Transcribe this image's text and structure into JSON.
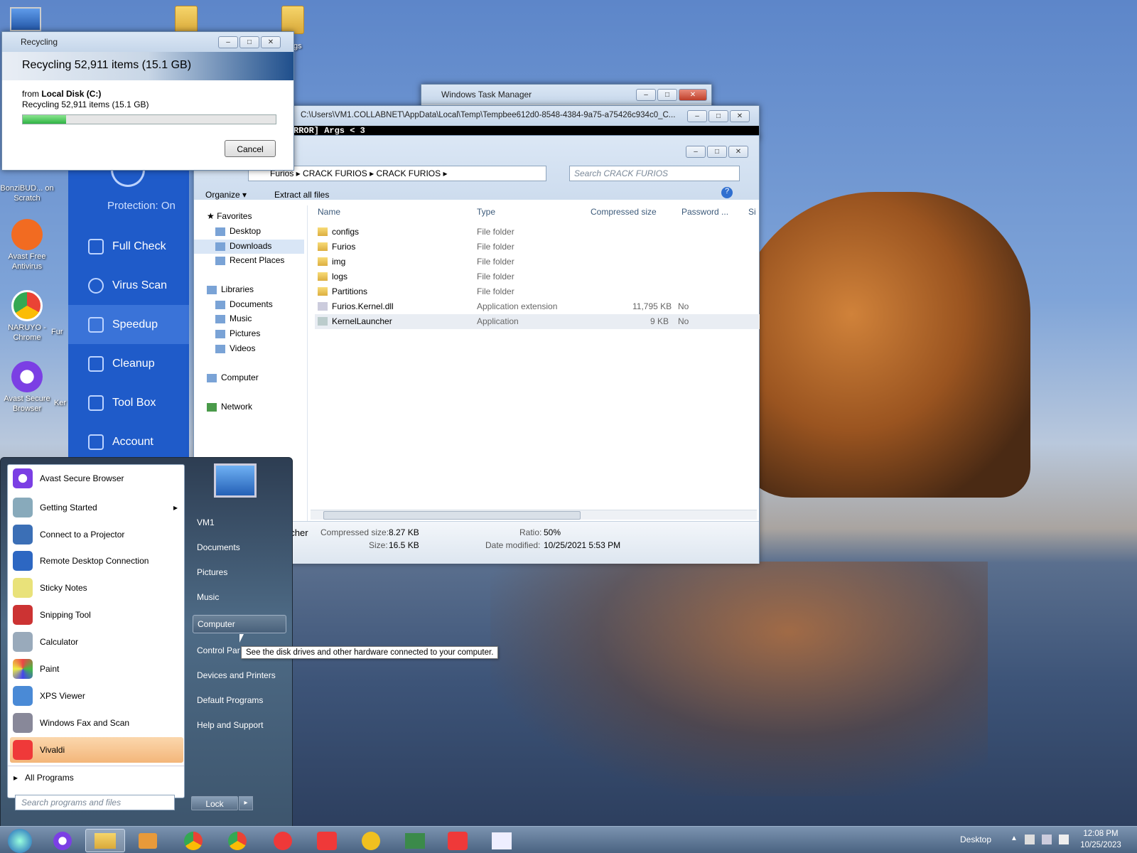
{
  "colors": {
    "accent": "#1f5bc9",
    "progress": "#33c14a",
    "highlight": "#f5c28a"
  },
  "desktop": {
    "icons": [
      {
        "label": "BonziBUD... on Scratch"
      },
      {
        "label": "Avast Free Antivirus"
      },
      {
        "label": "NARUYO - Chrome"
      },
      {
        "label": "Avast Secure Browser"
      },
      {
        "label": "afigs"
      },
      {
        "label": "Fur"
      },
      {
        "label": "Ker"
      }
    ]
  },
  "recycling": {
    "title": "Recycling",
    "heading": "Recycling 52,911 items (15.1 GB)",
    "from_prefix": "from",
    "from_drive": "Local Disk (C:)",
    "status": "Recycling 52,911 items (15.1 GB)",
    "progress": 0.17,
    "cancel": "Cancel"
  },
  "taskmgr": {
    "title": "Windows Task Manager"
  },
  "console": {
    "title": "C:\\Users\\VM1.COLLABNET\\AppData\\Local\\Temp\\Tempbee612d0-8548-4384-9a75-a75426c934c0_C...",
    "line": "RROR] Args < 3"
  },
  "avast": {
    "protection": "Protection: On",
    "items": [
      "Full Check",
      "Virus Scan",
      "Speedup",
      "Cleanup",
      "Tool Box",
      "Account"
    ]
  },
  "explorer": {
    "breadcrumb": [
      "Furios",
      "CRACK FURIOS",
      "CRACK FURIOS"
    ],
    "search_placeholder": "Search CRACK FURIOS",
    "organize": "Organize ▾",
    "extract": "Extract all files",
    "nav": {
      "favorites": "Favorites",
      "desktop": "Desktop",
      "downloads": "Downloads",
      "recent": "Recent Places",
      "libraries": "Libraries",
      "documents": "Documents",
      "music": "Music",
      "pictures": "Pictures",
      "videos": "Videos",
      "computer": "Computer",
      "network": "Network"
    },
    "columns": {
      "name": "Name",
      "type": "Type",
      "compressed": "Compressed size",
      "password": "Password ...",
      "size": "Si"
    },
    "files": [
      {
        "name": "configs",
        "type": "File folder",
        "csize": "",
        "pw": ""
      },
      {
        "name": "Furios",
        "type": "File folder",
        "csize": "",
        "pw": ""
      },
      {
        "name": "img",
        "type": "File folder",
        "csize": "",
        "pw": ""
      },
      {
        "name": "logs",
        "type": "File folder",
        "csize": "",
        "pw": ""
      },
      {
        "name": "Partitions",
        "type": "File folder",
        "csize": "",
        "pw": ""
      },
      {
        "name": "Furios.Kernel.dll",
        "type": "Application extension",
        "csize": "11,795 KB",
        "pw": "No"
      },
      {
        "name": "KernelLauncher",
        "type": "Application",
        "csize": "9 KB",
        "pw": "No"
      }
    ],
    "details": {
      "name_frag": "ncher",
      "csize_label": "Compressed size:",
      "csize_val": "8.27 KB",
      "size_label": "Size:",
      "size_val": "16.5 KB",
      "ratio_label": "Ratio:",
      "ratio_val": "50%",
      "date_label": "Date modified:",
      "date_val": "10/25/2021 5:53 PM"
    }
  },
  "startmenu": {
    "programs": [
      "Avast Secure Browser",
      "Getting Started",
      "Connect to a Projector",
      "Remote Desktop Connection",
      "Sticky Notes",
      "Snipping Tool",
      "Calculator",
      "Paint",
      "XPS Viewer",
      "Windows Fax and Scan",
      "Vivaldi"
    ],
    "all_programs": "All Programs",
    "search_placeholder": "Search programs and files",
    "right": [
      "VM1",
      "Documents",
      "Pictures",
      "Music",
      "Computer",
      "Control Par",
      "Devices and Printers",
      "Default Programs",
      "Help and Support"
    ],
    "lock": "Lock",
    "tooltip": "See the disk drives and other hardware connected to your computer."
  },
  "taskbar": {
    "desktop": "Desktop",
    "time": "12:08 PM",
    "date": "10/25/2023"
  }
}
